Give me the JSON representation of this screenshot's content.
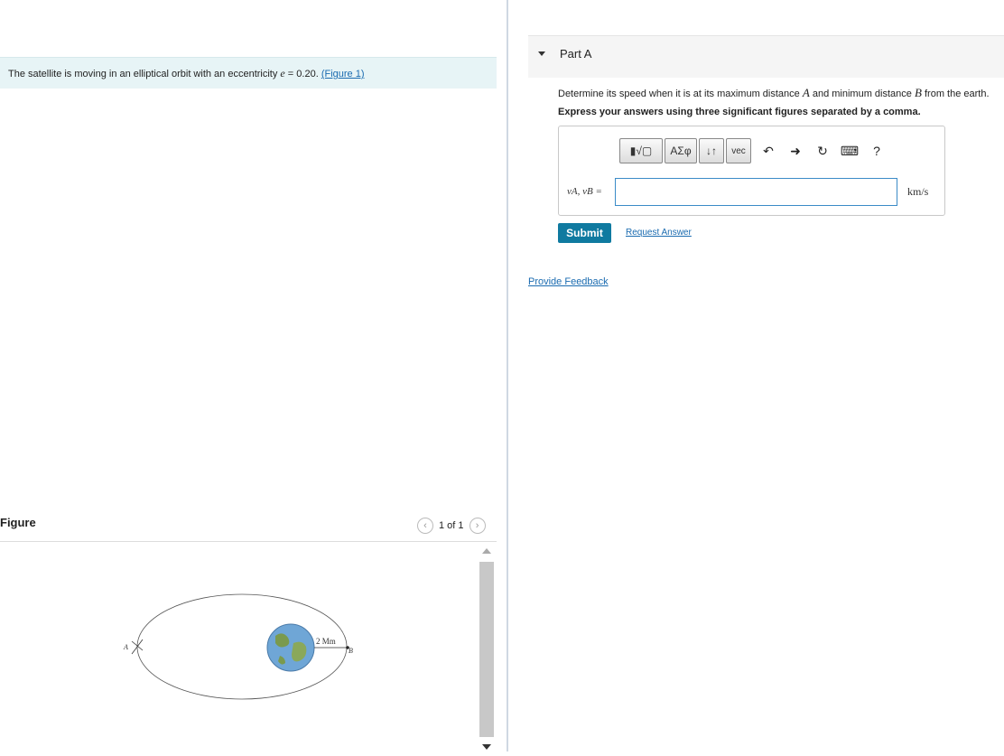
{
  "problem": {
    "intro_text": "The satellite is moving in an elliptical orbit with an eccentricity",
    "intro_var": "e",
    "intro_value": " = 0.20.",
    "figure_link": "(Figure 1)"
  },
  "figure": {
    "title": "Figure",
    "pager": "1 of 1",
    "label_A": "A",
    "label_B": "B",
    "label_dist": "2 Mm"
  },
  "part_a": {
    "title": "Part A",
    "question_pre": "Determine its speed when it is at its maximum distance",
    "var_A": "A",
    "question_mid": "and minimum distance",
    "var_B": "B",
    "question_post": "from the earth.",
    "instructions": "Express your answers using three significant figures separated by a comma.",
    "answer_label": "vA, vB =",
    "answer_value": "",
    "unit": "km/s",
    "submit_label": "Submit",
    "request_label": "Request Answer",
    "toolbar": {
      "templates": "▮√▢",
      "greek": "ΑΣφ",
      "arrows": "↓↑",
      "vec": "vec",
      "help": "?"
    }
  },
  "feedback_label": "Provide Feedback",
  "colors": {
    "accent": "#0f7aa0",
    "link": "#1a6bb0",
    "intro_bg": "#e7f4f6"
  }
}
